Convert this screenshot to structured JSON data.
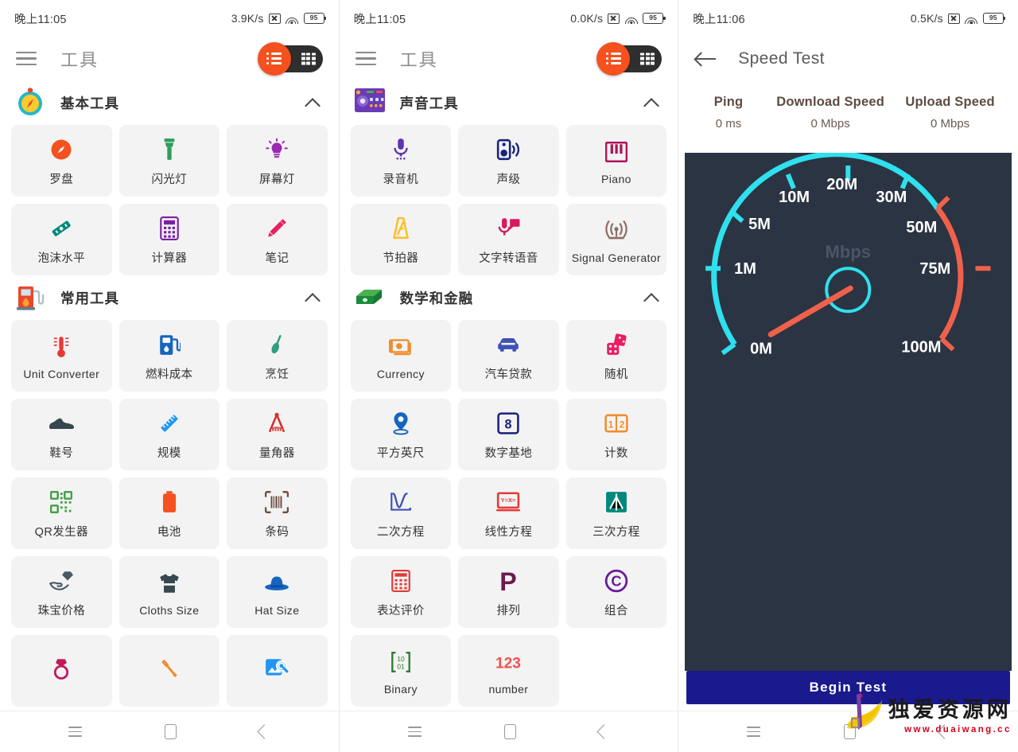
{
  "screens": [
    {
      "id": "tools-basic",
      "status": {
        "time": "晚上11:05",
        "netspeed": "3.9K/s",
        "battery": "95"
      },
      "appbar": {
        "title": "工具",
        "menu_icon": "hamburger-icon",
        "toggle_list_icon": "list-view-icon",
        "toggle_grid_icon": "grid-view-icon"
      },
      "sections": [
        {
          "title": "基本工具",
          "icon": "compass-icon",
          "collapsed": false,
          "tiles": [
            {
              "label": "罗盘",
              "icon": "compass-icon",
              "color": "#f4511e"
            },
            {
              "label": "闪光灯",
              "icon": "flashlight-icon",
              "color": "#2e9e5b"
            },
            {
              "label": "屏幕灯",
              "icon": "lightbulb-icon",
              "color": "#9c27b0"
            },
            {
              "label": "泡沫水平",
              "icon": "spirit-level-icon",
              "color": "#00897b"
            },
            {
              "label": "计算器",
              "icon": "calculator-icon",
              "color": "#7b1fa2"
            },
            {
              "label": "笔记",
              "icon": "pencil-note-icon",
              "color": "#e91e63"
            }
          ]
        },
        {
          "title": "常用工具",
          "icon": "gas-pump-icon",
          "collapsed": false,
          "tiles": [
            {
              "label": "Unit Converter",
              "icon": "thermometer-icon",
              "color": "#e53935"
            },
            {
              "label": "燃料成本",
              "icon": "fuel-cost-icon",
              "color": "#1565c0"
            },
            {
              "label": "烹饪",
              "icon": "cooking-spoon-icon",
              "color": "#2e9e7e"
            },
            {
              "label": "鞋号",
              "icon": "shoe-icon",
              "color": "#37474f"
            },
            {
              "label": "规模",
              "icon": "ruler-icon",
              "color": "#2196f3"
            },
            {
              "label": "量角器",
              "icon": "protractor-icon",
              "color": "#d32f2f"
            },
            {
              "label": "QR发生器",
              "icon": "qr-code-icon",
              "color": "#43a047"
            },
            {
              "label": "电池",
              "icon": "battery-icon",
              "color": "#f4511e"
            },
            {
              "label": "条码",
              "icon": "barcode-icon",
              "color": "#6d4c41"
            },
            {
              "label": "珠宝价格",
              "icon": "jewelry-price-icon",
              "color": "#455a64"
            },
            {
              "label": "Cloths Size",
              "icon": "tshirt-icon",
              "color": "#37474f"
            },
            {
              "label": "Hat Size",
              "icon": "hat-icon",
              "color": "#1565c0"
            },
            {
              "label": "",
              "icon": "ring-icon",
              "color": "#c2185b"
            },
            {
              "label": "",
              "icon": "screwdriver-icon",
              "color": "#ef8e31"
            },
            {
              "label": "",
              "icon": "image-search-icon",
              "color": "#2196f3"
            }
          ]
        }
      ],
      "navbar": {
        "recents": "recents-icon",
        "home": "home-icon",
        "back": "back-icon"
      }
    },
    {
      "id": "tools-sound-math",
      "status": {
        "time": "晚上11:05",
        "netspeed": "0.0K/s",
        "battery": "95"
      },
      "appbar": {
        "title": "工具",
        "menu_icon": "hamburger-icon",
        "toggle_list_icon": "list-view-icon",
        "toggle_grid_icon": "grid-view-icon"
      },
      "sections": [
        {
          "title": "声音工具",
          "icon": "dj-mixer-icon",
          "collapsed": false,
          "tiles": [
            {
              "label": "录音机",
              "icon": "microphone-icon",
              "color": "#5e35b1"
            },
            {
              "label": "声级",
              "icon": "speaker-icon",
              "color": "#1a237e"
            },
            {
              "label": "Piano",
              "icon": "piano-icon",
              "color": "#ad1457"
            },
            {
              "label": "节拍器",
              "icon": "metronome-icon",
              "color": "#fbc02d"
            },
            {
              "label": "文字转语音",
              "icon": "text-to-speech-icon",
              "color": "#d81b60"
            },
            {
              "label": "Signal Generator",
              "icon": "signal-generator-icon",
              "color": "#8d6e63"
            }
          ]
        },
        {
          "title": "数学和金融",
          "icon": "money-stack-icon",
          "collapsed": false,
          "tiles": [
            {
              "label": "Currency",
              "icon": "currency-icon",
              "color": "#ef8e31"
            },
            {
              "label": "汽车贷款",
              "icon": "car-loan-icon",
              "color": "#3f51b5"
            },
            {
              "label": "随机",
              "icon": "dice-icon",
              "color": "#e91e63"
            },
            {
              "label": "平方英尺",
              "icon": "location-pin-icon",
              "color": "#1565c0"
            },
            {
              "label": "数字基地",
              "icon": "number-base-icon",
              "color": "#1a237e"
            },
            {
              "label": "计数",
              "icon": "counter-icon",
              "color": "#ef8e31"
            },
            {
              "label": "二次方程",
              "icon": "quadratic-equation-icon",
              "color": "#3f51b5"
            },
            {
              "label": "线性方程",
              "icon": "linear-equation-icon",
              "color": "#e53935"
            },
            {
              "label": "三次方程",
              "icon": "cubic-equation-icon",
              "color": "#00897b"
            },
            {
              "label": "表达评价",
              "icon": "expression-eval-icon",
              "color": "#e53935"
            },
            {
              "label": "排列",
              "icon": "permutation-icon",
              "color": "#6a1b4d"
            },
            {
              "label": "组合",
              "icon": "combination-icon",
              "color": "#6a1b9a"
            },
            {
              "label": "Binary",
              "icon": "binary-matrix-icon",
              "color": "#2e7d32"
            },
            {
              "label": "number",
              "icon": "number-123-icon",
              "color": "#ef5350"
            }
          ]
        }
      ],
      "navbar": {
        "recents": "recents-icon",
        "home": "home-icon",
        "back": "back-icon"
      }
    },
    {
      "id": "speed-test",
      "status": {
        "time": "晚上11:06",
        "netspeed": "0.5K/s",
        "battery": "95"
      },
      "appbar": {
        "title": "Speed Test",
        "back_icon": "arrow-back-icon"
      },
      "stats": [
        {
          "label": "Ping",
          "value": "0 ms"
        },
        {
          "label": "Download Speed",
          "value": "0 Mbps"
        },
        {
          "label": "Upload Speed",
          "value": "0 Mbps"
        }
      ],
      "gauge": {
        "unit": "Mbps",
        "needle_value": 0,
        "ticks": [
          "0M",
          "1M",
          "5M",
          "10M",
          "20M",
          "30M",
          "50M",
          "75M",
          "100M"
        ],
        "arc_color_low": "#2fe0ee",
        "arc_color_high": "#f0614b",
        "background": "#2b3442"
      },
      "begin_button": "Begin Test",
      "navbar": {
        "recents": "recents-icon",
        "home": "home-icon",
        "back": "back-icon"
      }
    }
  ],
  "watermark": {
    "cn": "独爱资源网",
    "url": "www.duaiwang.cc"
  }
}
